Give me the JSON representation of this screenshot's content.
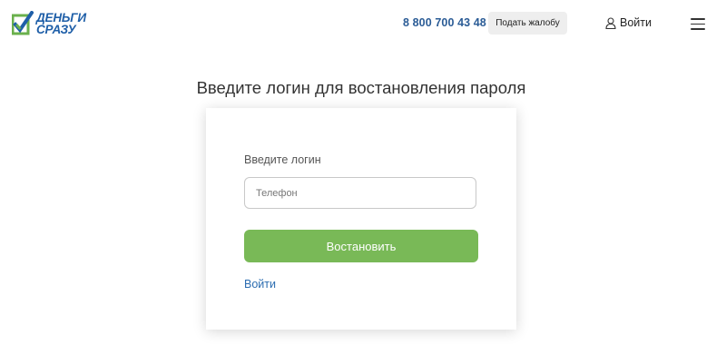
{
  "header": {
    "logo": {
      "line1": "ДЕНЬГИ",
      "line2": "СРАЗУ"
    },
    "phone": "8 800 700 43 48",
    "complaint_label": "Подать жалобу",
    "login_label": "Войти",
    "menu_icon": "hamburger-menu-icon",
    "user_icon": "user-icon"
  },
  "main": {
    "title": "Введите логин для востановления пароля",
    "form": {
      "field_label": "Введите логин",
      "phone_placeholder": "Телефон",
      "phone_value": "",
      "submit_label": "Востановить",
      "login_link": "Войти"
    }
  },
  "colors": {
    "brand_blue": "#1f5fa8",
    "brand_green": "#6ab04c",
    "button_green": "#79b957",
    "link_blue": "#2b6cb0"
  }
}
